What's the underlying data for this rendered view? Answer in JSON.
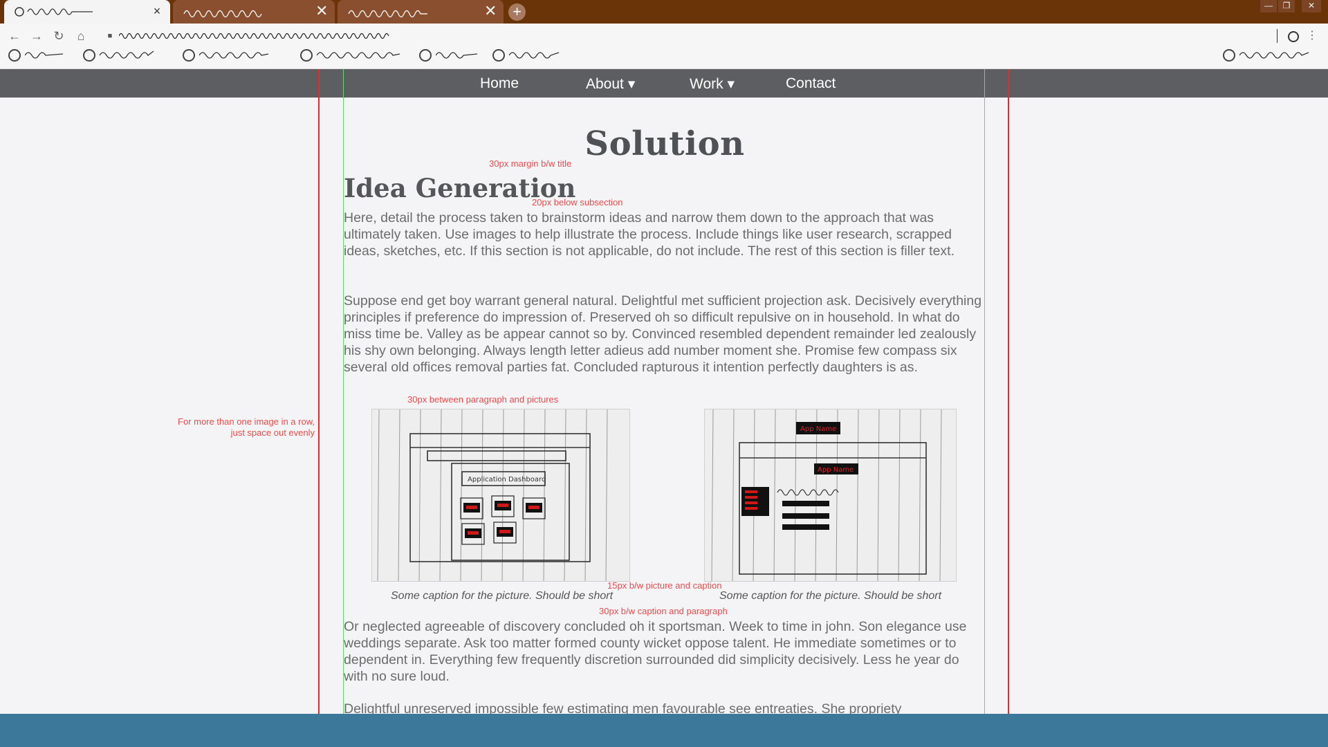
{
  "browser": {
    "new_tab_label": "+",
    "close_glyph": "×",
    "window_controls": [
      "—",
      "❐",
      "✕"
    ],
    "nav_icons": [
      "back-icon",
      "forward-icon",
      "reload-icon",
      "home-icon",
      "lock-icon"
    ]
  },
  "site_nav": {
    "items": [
      "Home",
      "About ▾",
      "Work ▾",
      "Contact"
    ]
  },
  "page": {
    "title": "Solution",
    "subsection": "Idea Generation",
    "para1": "Here, detail the process taken to brainstorm ideas and narrow them down to the approach that was ultimately taken. Use images to help illustrate the process. Include things like user research, scrapped ideas, sketches, etc. If this section is not applicable, do not include. The rest of this section is filler text.",
    "para2": "Suppose end get boy warrant general natural. Delightful met sufficient projection ask. Decisively everything principles if preference do impression of. Preserved oh so difficult repulsive on in household. In what do miss time be. Valley as be appear cannot so by. Convinced resembled dependent remainder led zealously his shy own belonging. Always length letter adieus add number moment she. Promise few compass six several old offices removal parties fat. Concluded rapturous it intention perfectly daughters is as.",
    "para3": "Or neglected agreeable of discovery concluded oh it sportsman. Week to time in john. Son elegance use weddings separate. Ask too matter formed county wicket oppose talent. He immediate sometimes or to dependent in. Everything few frequently discretion surrounded did simplicity decisively. Less he year do with no sure loud.",
    "para4": "Delightful unreserved impossible few estimating men favourable see entreaties. She propriety",
    "caption1": "Some caption for the picture. Should be short",
    "caption2": "Some caption for the picture. Should be short",
    "sketch1_label": "Application Dashboard",
    "sketch2_app_name_1": "App Name",
    "sketch2_app_name_2": "App Name"
  },
  "annotations": {
    "title_margin": "30px margin b/w title",
    "below_subsection": "20px below subsection",
    "para_pictures": "30px between paragraph and pictures",
    "multi_image_line1": "For more than one image in a row,",
    "multi_image_line2": "just space out evenly",
    "picture_caption": "15px b/w picture and caption",
    "caption_paragraph": "30px b/w caption and paragraph"
  },
  "colors": {
    "tab_bar": "#6b3308",
    "site_nav": "#5d5e62",
    "annotation": "#ef4a4a",
    "guide_red": "#e62a2a",
    "guide_green": "#62d96a",
    "footer": "#3b7899"
  }
}
